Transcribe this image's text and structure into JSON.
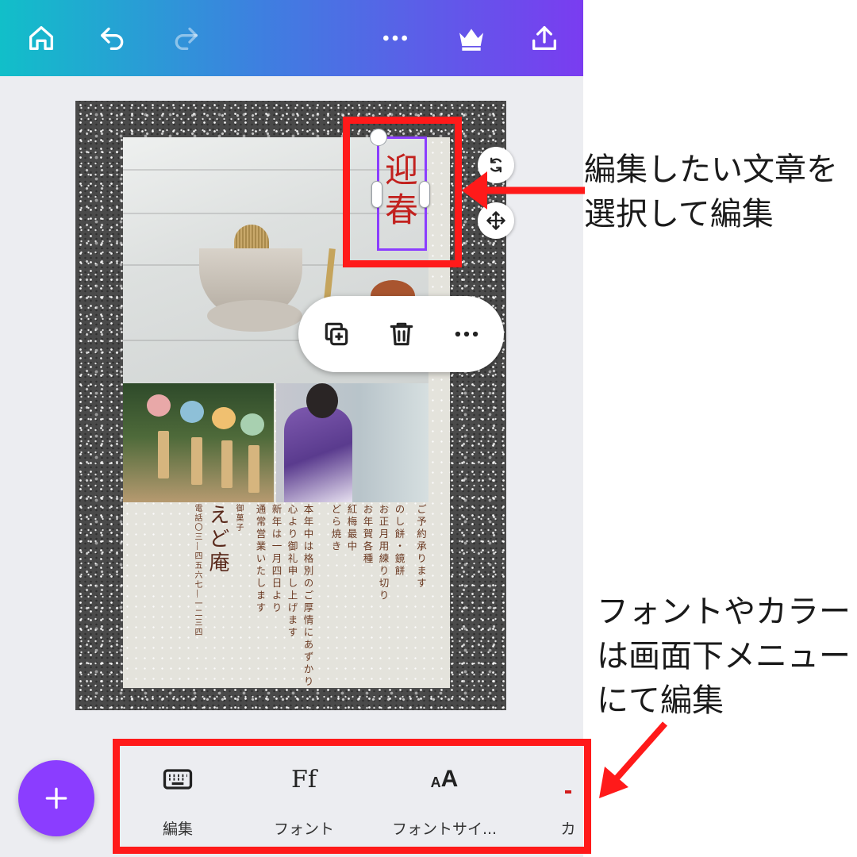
{
  "topbar": {
    "buttons": [
      "home",
      "undo",
      "redo",
      "more",
      "premium",
      "share"
    ]
  },
  "design": {
    "title_chars": [
      "迎",
      "春"
    ],
    "text_columns": [
      "ご予約承ります",
      "のし餅・鏡餅",
      "お正月用練り切り",
      "お年賀各種",
      "紅梅最中",
      "どら焼き",
      "",
      "本年中は格別のご厚情にあずかり",
      "心より御礼申し上げます",
      "新年は一月四日より",
      "通常営業いたします",
      "",
      "御菓子",
      "えど庵",
      "電話〇三―四五六七―一二三四"
    ]
  },
  "context_menu": {
    "items": [
      "duplicate",
      "delete",
      "more"
    ]
  },
  "toolbar": {
    "edit_label": "編集",
    "font_label": "フォント",
    "font_size_label": "フォントサイ...",
    "color_label": "カ",
    "font_icon_text": "Ff",
    "font_size_icon_small": "A",
    "font_size_icon_large": "A"
  },
  "annotations": {
    "top_line1": "編集したい文章を",
    "top_line2": "選択して編集",
    "bottom_line1": "フォントやカラー",
    "bottom_line2": "は画面下メニュー",
    "bottom_line3": "にて編集"
  },
  "colors": {
    "accent_purple": "#8b3dff",
    "annotation_red": "#ff1a1a",
    "title_red": "#c2211e"
  }
}
